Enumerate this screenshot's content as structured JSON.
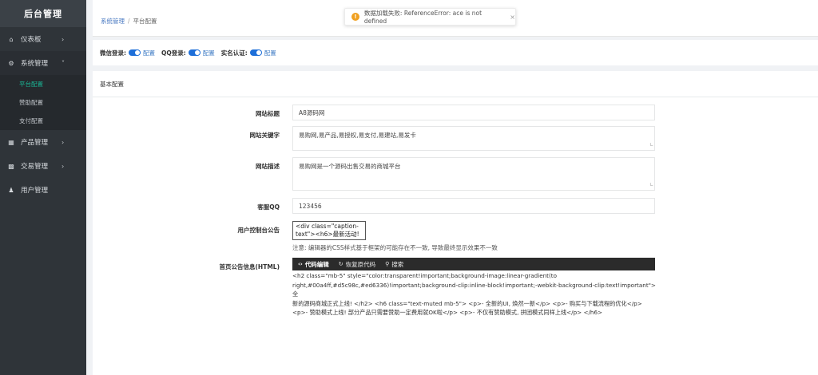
{
  "sidebar": {
    "title": "后台管理",
    "items": [
      {
        "label": "仪表板",
        "icon": "home-icon"
      },
      {
        "label": "系统管理",
        "icon": "gear-icon"
      },
      {
        "label": "产品管理",
        "icon": "box-icon"
      },
      {
        "label": "交易管理",
        "icon": "exchange-icon"
      },
      {
        "label": "用户管理",
        "icon": "user-icon"
      }
    ],
    "subitems": [
      {
        "label": "平台配置",
        "active": true
      },
      {
        "label": "赞助配置",
        "active": false
      },
      {
        "label": "支付配置",
        "active": false
      }
    ]
  },
  "breadcrumb": {
    "parent": "系统管理",
    "separator": "/",
    "current": "平台配置"
  },
  "toast": {
    "message": "数据加载失败: ReferenceError: ace is not defined",
    "close": "×"
  },
  "toggles": [
    {
      "label": "微信登录:",
      "link": "配置"
    },
    {
      "label": "QQ登录:",
      "link": "配置"
    },
    {
      "label": "实名认证:",
      "link": "配置"
    }
  ],
  "panel": {
    "title": "基本配置"
  },
  "form": {
    "site_title": {
      "label": "网站标题",
      "value": "A8源码网"
    },
    "site_keywords": {
      "label": "网站关键字",
      "value": "易购网,易产品,易授权,易支付,易建站,易发卡"
    },
    "site_description": {
      "label": "网站描述",
      "value": "易购网是一个源码出售交易的商城平台"
    },
    "service_qq": {
      "label": "客服QQ",
      "value": "123456"
    },
    "user_notice": {
      "label": "用户控制台公告",
      "value": "<div class=\"caption-text\"><h6>最新活动!",
      "note": "注意: 编辑器的CSS样式基于框架的可能存在不一致, 导致最终显示效果不一致"
    },
    "home_notice": {
      "label": "首页公告信息(HTML)",
      "tabs": [
        {
          "label": "代码编辑",
          "icon": "code-icon"
        },
        {
          "label": "恢复原代码",
          "icon": "refresh-icon"
        },
        {
          "label": "搜索",
          "icon": "search-icon"
        }
      ],
      "code_lines": [
        "<h2 class=\"mb-5\" style=\"color:transparent!important;background-image:linear-gradient(to",
        "right,#00a4ff,#d5c98c,#ed6336)!important;background-clip:inline-block!important;-webkit-background-clip:text!important\"> 全",
        "新的源码商城正式上线! </h2> <h6 class=\"text-muted mb-5\"> <p>- 全新的UI, 焕然一新</p> <p>- 购买与下载流程的优化</p>",
        "<p>- 赞助模式上线! 部分产品只需要赞助一定费用就OK啦</p> <p>- 不仅有赞助模式, 拼团模式同样上线</p> </h6>"
      ]
    }
  },
  "colors": {
    "accent": "#1ab394",
    "toggle": "#1e6fd9",
    "link": "#3a78c3",
    "sidebar": "#2f3439"
  }
}
